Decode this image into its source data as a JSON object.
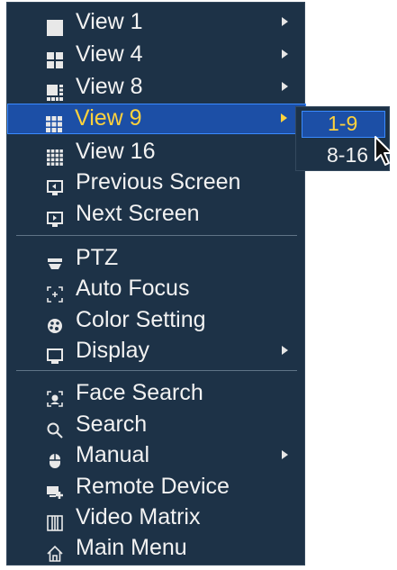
{
  "menu": {
    "items": [
      {
        "label": "View 1",
        "icon": "single-view-icon",
        "submenu": true
      },
      {
        "label": "View 4",
        "icon": "quad-view-icon",
        "submenu": true
      },
      {
        "label": "View 8",
        "icon": "eight-view-icon",
        "submenu": true
      },
      {
        "label": "View 9",
        "icon": "nine-view-icon",
        "submenu": true,
        "selected": true
      },
      {
        "label": "View 16",
        "icon": "sixteen-view-icon",
        "submenu": false
      },
      {
        "label": "Previous Screen",
        "icon": "previous-screen-icon",
        "submenu": false
      },
      {
        "label": "Next Screen",
        "icon": "next-screen-icon",
        "submenu": false
      },
      {
        "label": "PTZ",
        "icon": "ptz-icon",
        "submenu": false
      },
      {
        "label": "Auto Focus",
        "icon": "auto-focus-icon",
        "submenu": false
      },
      {
        "label": "Color Setting",
        "icon": "color-setting-icon",
        "submenu": false
      },
      {
        "label": "Display",
        "icon": "display-icon",
        "submenu": true
      },
      {
        "label": "Face Search",
        "icon": "face-search-icon",
        "submenu": false
      },
      {
        "label": "Search",
        "icon": "search-icon",
        "submenu": false
      },
      {
        "label": "Manual",
        "icon": "manual-icon",
        "submenu": true
      },
      {
        "label": "Remote Device",
        "icon": "remote-device-icon",
        "submenu": false
      },
      {
        "label": "Video Matrix",
        "icon": "video-matrix-icon",
        "submenu": false
      },
      {
        "label": "Main Menu",
        "icon": "home-icon",
        "submenu": false
      }
    ]
  },
  "submenu": {
    "items": [
      {
        "label": "1-9",
        "selected": true
      },
      {
        "label": "8-16",
        "selected": false
      }
    ]
  },
  "colors": {
    "menu_background": "#1d3247",
    "selected_background": "#1c4fa6",
    "selected_border": "#3a8aff",
    "selected_text": "#ffd23c",
    "text": "#f2f2f2"
  }
}
